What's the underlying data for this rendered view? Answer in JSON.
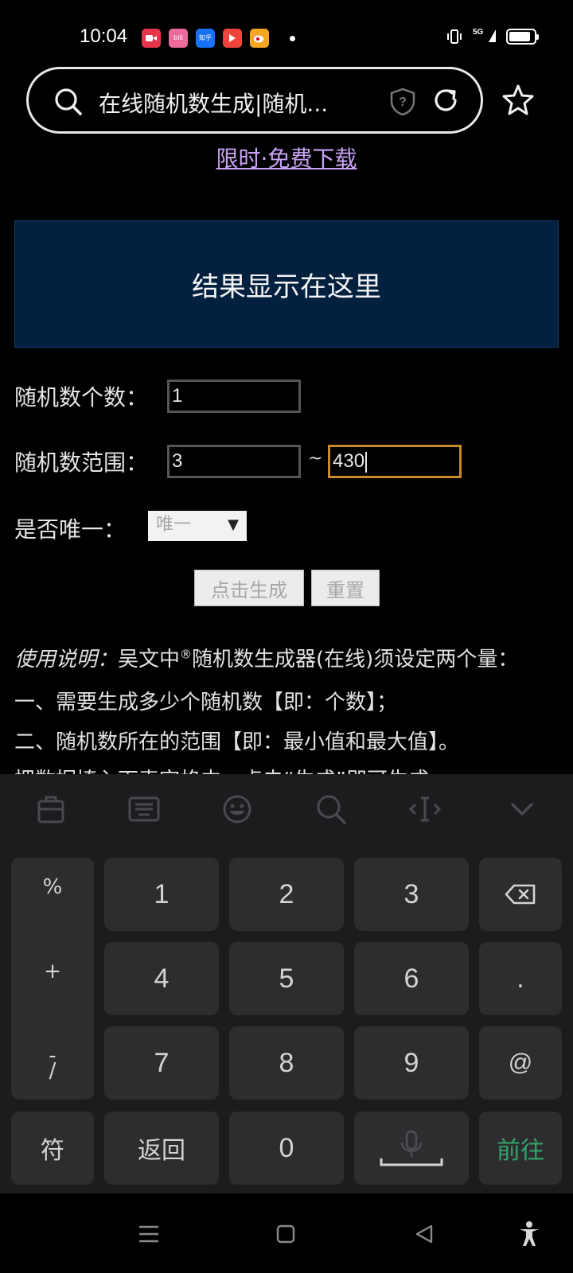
{
  "status_bar": {
    "time": "10:04",
    "notifications": [
      {
        "icon": "video-app-icon",
        "label": "",
        "color": "#e8344b"
      },
      {
        "icon": "bilibili-icon",
        "label": "bili",
        "color": "#ef6a9c"
      },
      {
        "icon": "zhihu-icon",
        "label": "知乎",
        "color": "#1772f6"
      },
      {
        "icon": "play-app-icon",
        "label": "",
        "color": "#f0433b"
      },
      {
        "icon": "weibo-icon",
        "label": "",
        "color": "#f5a623"
      }
    ],
    "network": "5G",
    "battery_level": 0.85
  },
  "browser": {
    "url_title": "在线随机数生成|随机...",
    "colors": {
      "outline": "#e8e8e8"
    }
  },
  "page": {
    "promo_link": "限时·免费下载",
    "result_text": "结果显示在这里",
    "count_label": "随机数个数：",
    "count_value": "1",
    "range_label": "随机数范围：",
    "range_min": "3",
    "range_sep": "~",
    "range_max": "430",
    "unique_label": "是否唯一：",
    "unique_selected": "唯一",
    "generate_button": "点击生成",
    "reset_button": "重置",
    "instructions": {
      "prefix": "使用说明：",
      "line1_rest_a": "吴文中",
      "line1_mark": "®",
      "line1_rest_b": "随机数生成器(在线)须设定两个量：",
      "line2": "一、需要生成多少个随机数【即：个数】；",
      "line3": "二、随机数所在的范围【即：最小值和最大值】。",
      "line4": "把数据填入下表空格中，点击“生成”即可生成"
    }
  },
  "keyboard": {
    "toolbar": [
      "clipboard-icon",
      "keyboard-icon",
      "emoji-icon",
      "search-icon",
      "cursor-icon",
      "collapse-icon"
    ],
    "symbols": [
      "%",
      "+",
      "-",
      "/"
    ],
    "digits": [
      "1",
      "2",
      "3",
      "4",
      "5",
      "6",
      "7",
      "8",
      "9",
      "0"
    ],
    "dot": ".",
    "at": "@",
    "sym_key": "符",
    "back_key": "返回",
    "go_key": "前往",
    "colors": {
      "go": "#32a36b",
      "key": "#2d2d30"
    }
  }
}
